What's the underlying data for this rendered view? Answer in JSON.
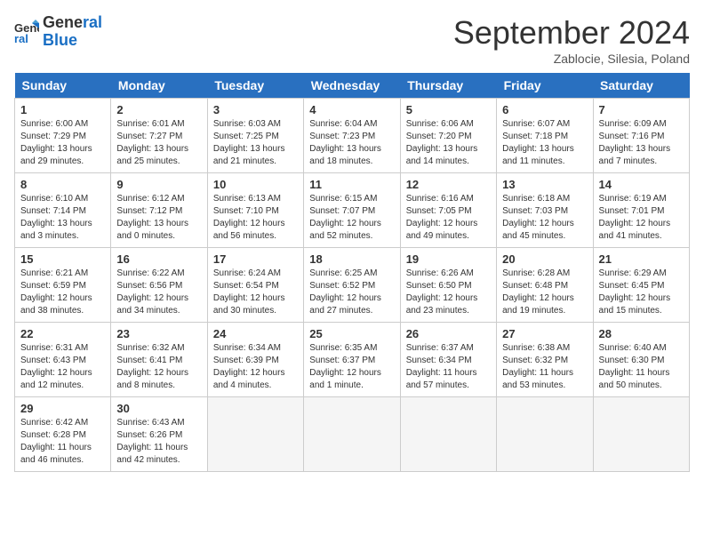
{
  "header": {
    "logo_line1": "General",
    "logo_line2": "Blue",
    "month": "September 2024",
    "location": "Zablocie, Silesia, Poland"
  },
  "days_of_week": [
    "Sunday",
    "Monday",
    "Tuesday",
    "Wednesday",
    "Thursday",
    "Friday",
    "Saturday"
  ],
  "weeks": [
    [
      {
        "day": "1",
        "lines": [
          "Sunrise: 6:00 AM",
          "Sunset: 7:29 PM",
          "Daylight: 13 hours",
          "and 29 minutes."
        ]
      },
      {
        "day": "2",
        "lines": [
          "Sunrise: 6:01 AM",
          "Sunset: 7:27 PM",
          "Daylight: 13 hours",
          "and 25 minutes."
        ]
      },
      {
        "day": "3",
        "lines": [
          "Sunrise: 6:03 AM",
          "Sunset: 7:25 PM",
          "Daylight: 13 hours",
          "and 21 minutes."
        ]
      },
      {
        "day": "4",
        "lines": [
          "Sunrise: 6:04 AM",
          "Sunset: 7:23 PM",
          "Daylight: 13 hours",
          "and 18 minutes."
        ]
      },
      {
        "day": "5",
        "lines": [
          "Sunrise: 6:06 AM",
          "Sunset: 7:20 PM",
          "Daylight: 13 hours",
          "and 14 minutes."
        ]
      },
      {
        "day": "6",
        "lines": [
          "Sunrise: 6:07 AM",
          "Sunset: 7:18 PM",
          "Daylight: 13 hours",
          "and 11 minutes."
        ]
      },
      {
        "day": "7",
        "lines": [
          "Sunrise: 6:09 AM",
          "Sunset: 7:16 PM",
          "Daylight: 13 hours",
          "and 7 minutes."
        ]
      }
    ],
    [
      {
        "day": "8",
        "lines": [
          "Sunrise: 6:10 AM",
          "Sunset: 7:14 PM",
          "Daylight: 13 hours",
          "and 3 minutes."
        ]
      },
      {
        "day": "9",
        "lines": [
          "Sunrise: 6:12 AM",
          "Sunset: 7:12 PM",
          "Daylight: 13 hours",
          "and 0 minutes."
        ]
      },
      {
        "day": "10",
        "lines": [
          "Sunrise: 6:13 AM",
          "Sunset: 7:10 PM",
          "Daylight: 12 hours",
          "and 56 minutes."
        ]
      },
      {
        "day": "11",
        "lines": [
          "Sunrise: 6:15 AM",
          "Sunset: 7:07 PM",
          "Daylight: 12 hours",
          "and 52 minutes."
        ]
      },
      {
        "day": "12",
        "lines": [
          "Sunrise: 6:16 AM",
          "Sunset: 7:05 PM",
          "Daylight: 12 hours",
          "and 49 minutes."
        ]
      },
      {
        "day": "13",
        "lines": [
          "Sunrise: 6:18 AM",
          "Sunset: 7:03 PM",
          "Daylight: 12 hours",
          "and 45 minutes."
        ]
      },
      {
        "day": "14",
        "lines": [
          "Sunrise: 6:19 AM",
          "Sunset: 7:01 PM",
          "Daylight: 12 hours",
          "and 41 minutes."
        ]
      }
    ],
    [
      {
        "day": "15",
        "lines": [
          "Sunrise: 6:21 AM",
          "Sunset: 6:59 PM",
          "Daylight: 12 hours",
          "and 38 minutes."
        ]
      },
      {
        "day": "16",
        "lines": [
          "Sunrise: 6:22 AM",
          "Sunset: 6:56 PM",
          "Daylight: 12 hours",
          "and 34 minutes."
        ]
      },
      {
        "day": "17",
        "lines": [
          "Sunrise: 6:24 AM",
          "Sunset: 6:54 PM",
          "Daylight: 12 hours",
          "and 30 minutes."
        ]
      },
      {
        "day": "18",
        "lines": [
          "Sunrise: 6:25 AM",
          "Sunset: 6:52 PM",
          "Daylight: 12 hours",
          "and 27 minutes."
        ]
      },
      {
        "day": "19",
        "lines": [
          "Sunrise: 6:26 AM",
          "Sunset: 6:50 PM",
          "Daylight: 12 hours",
          "and 23 minutes."
        ]
      },
      {
        "day": "20",
        "lines": [
          "Sunrise: 6:28 AM",
          "Sunset: 6:48 PM",
          "Daylight: 12 hours",
          "and 19 minutes."
        ]
      },
      {
        "day": "21",
        "lines": [
          "Sunrise: 6:29 AM",
          "Sunset: 6:45 PM",
          "Daylight: 12 hours",
          "and 15 minutes."
        ]
      }
    ],
    [
      {
        "day": "22",
        "lines": [
          "Sunrise: 6:31 AM",
          "Sunset: 6:43 PM",
          "Daylight: 12 hours",
          "and 12 minutes."
        ]
      },
      {
        "day": "23",
        "lines": [
          "Sunrise: 6:32 AM",
          "Sunset: 6:41 PM",
          "Daylight: 12 hours",
          "and 8 minutes."
        ]
      },
      {
        "day": "24",
        "lines": [
          "Sunrise: 6:34 AM",
          "Sunset: 6:39 PM",
          "Daylight: 12 hours",
          "and 4 minutes."
        ]
      },
      {
        "day": "25",
        "lines": [
          "Sunrise: 6:35 AM",
          "Sunset: 6:37 PM",
          "Daylight: 12 hours",
          "and 1 minute."
        ]
      },
      {
        "day": "26",
        "lines": [
          "Sunrise: 6:37 AM",
          "Sunset: 6:34 PM",
          "Daylight: 11 hours",
          "and 57 minutes."
        ]
      },
      {
        "day": "27",
        "lines": [
          "Sunrise: 6:38 AM",
          "Sunset: 6:32 PM",
          "Daylight: 11 hours",
          "and 53 minutes."
        ]
      },
      {
        "day": "28",
        "lines": [
          "Sunrise: 6:40 AM",
          "Sunset: 6:30 PM",
          "Daylight: 11 hours",
          "and 50 minutes."
        ]
      }
    ],
    [
      {
        "day": "29",
        "lines": [
          "Sunrise: 6:42 AM",
          "Sunset: 6:28 PM",
          "Daylight: 11 hours",
          "and 46 minutes."
        ]
      },
      {
        "day": "30",
        "lines": [
          "Sunrise: 6:43 AM",
          "Sunset: 6:26 PM",
          "Daylight: 11 hours",
          "and 42 minutes."
        ]
      },
      {
        "day": "",
        "lines": []
      },
      {
        "day": "",
        "lines": []
      },
      {
        "day": "",
        "lines": []
      },
      {
        "day": "",
        "lines": []
      },
      {
        "day": "",
        "lines": []
      }
    ]
  ]
}
